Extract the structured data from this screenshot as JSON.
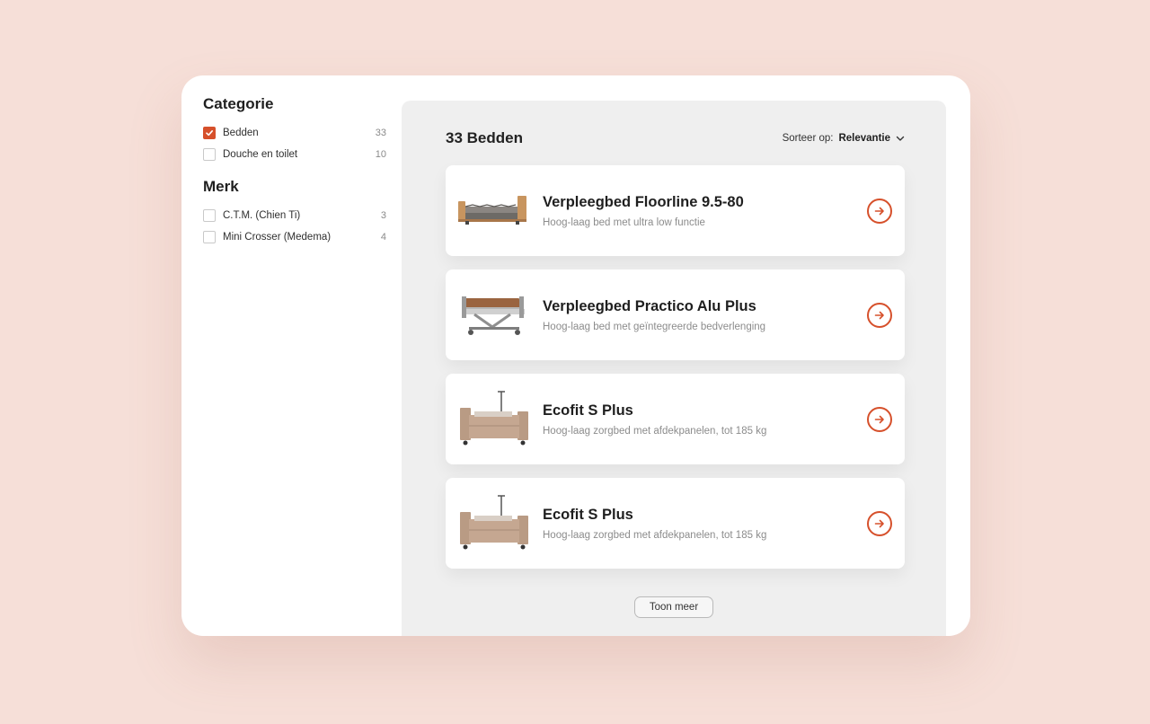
{
  "sidebar": {
    "categories": {
      "title": "Categorie",
      "items": [
        {
          "label": "Bedden",
          "count": "33",
          "checked": true
        },
        {
          "label": "Douche en toilet",
          "count": "10",
          "checked": false
        }
      ]
    },
    "brands": {
      "title": "Merk",
      "items": [
        {
          "label": "C.T.M. (Chien Ti)",
          "count": "3",
          "checked": false
        },
        {
          "label": "Mini Crosser (Medema)",
          "count": "4",
          "checked": false
        }
      ]
    }
  },
  "main": {
    "title": "33 Bedden",
    "sort_label": "Sorteer op:",
    "sort_value": "Relevantie",
    "products": [
      {
        "title": "Verpleegbed Floorline 9.5-80",
        "subtitle": "Hoog-laag bed met ultra low functie",
        "image": "floorline-bed"
      },
      {
        "title": "Verpleegbed Practico Alu Plus",
        "subtitle": "Hoog-laag bed met geïntegreerde bedverlenging",
        "image": "practico-bed"
      },
      {
        "title": "Ecofit S Plus",
        "subtitle": "Hoog-laag zorgbed met afdekpanelen, tot 185 kg",
        "image": "ecofit-bed"
      },
      {
        "title": "Ecofit S Plus",
        "subtitle": "Hoog-laag zorgbed met afdekpanelen, tot 185 kg",
        "image": "ecofit-bed"
      }
    ],
    "more_button": "Toon meer"
  },
  "colors": {
    "accent": "#d6502b",
    "background": "#f6dfd8",
    "panel": "#efefef"
  },
  "icons": [
    "checkmark-icon",
    "chevron-down-icon",
    "arrow-right-circle-icon"
  ]
}
